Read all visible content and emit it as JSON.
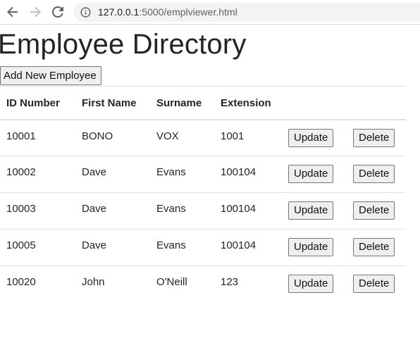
{
  "browser": {
    "url_host": "127.0.0.1",
    "url_path": ":5000/emplviewer.html"
  },
  "page": {
    "title": "Employee Directory",
    "add_button_label": "Add New Employee"
  },
  "table": {
    "headers": [
      "ID Number",
      "First Name",
      "Surname",
      "Extension"
    ],
    "update_label": "Update",
    "delete_label": "Delete",
    "rows": [
      {
        "id": "10001",
        "first": "BONO",
        "surname": "VOX",
        "ext": "1001"
      },
      {
        "id": "10002",
        "first": "Dave",
        "surname": "Evans",
        "ext": "100104"
      },
      {
        "id": "10003",
        "first": "Dave",
        "surname": "Evans",
        "ext": "100104"
      },
      {
        "id": "10005",
        "first": "Dave",
        "surname": "Evans",
        "ext": "100104"
      },
      {
        "id": "10020",
        "first": "John",
        "surname": "O'Neill",
        "ext": "123"
      }
    ]
  },
  "icons": {
    "back": "arrow-left-icon",
    "forward": "arrow-right-icon",
    "reload": "reload-icon",
    "site_info": "info-icon"
  }
}
